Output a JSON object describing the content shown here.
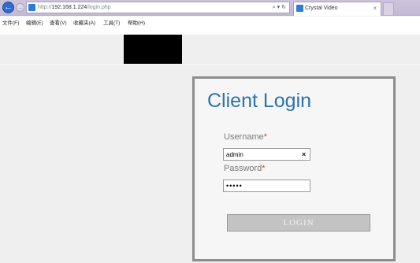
{
  "browser": {
    "url_scheme": "http://",
    "url_host": "192.168.1.224",
    "url_path": "/login.php",
    "search_icon": "⌕",
    "addr_glyphs": "▾ ↻",
    "tab_title": "Crystal Video",
    "tab_close": "×"
  },
  "menu": [
    "文件(F)",
    "编辑(E)",
    "查看(V)",
    "收藏夹(A)",
    "工具(T)",
    "帮助(H)"
  ],
  "login": {
    "title": "Client Login",
    "username_label": "Username",
    "password_label": "Password",
    "required_mark": "*",
    "username_value": "admin",
    "password_value": "•••••",
    "clear_glyph": "×",
    "button_label": "LOGIN"
  },
  "colors": {
    "title_blue": "#2e73a8",
    "required_red": "#e33b3b",
    "button_gray": "#c3c3c3"
  }
}
